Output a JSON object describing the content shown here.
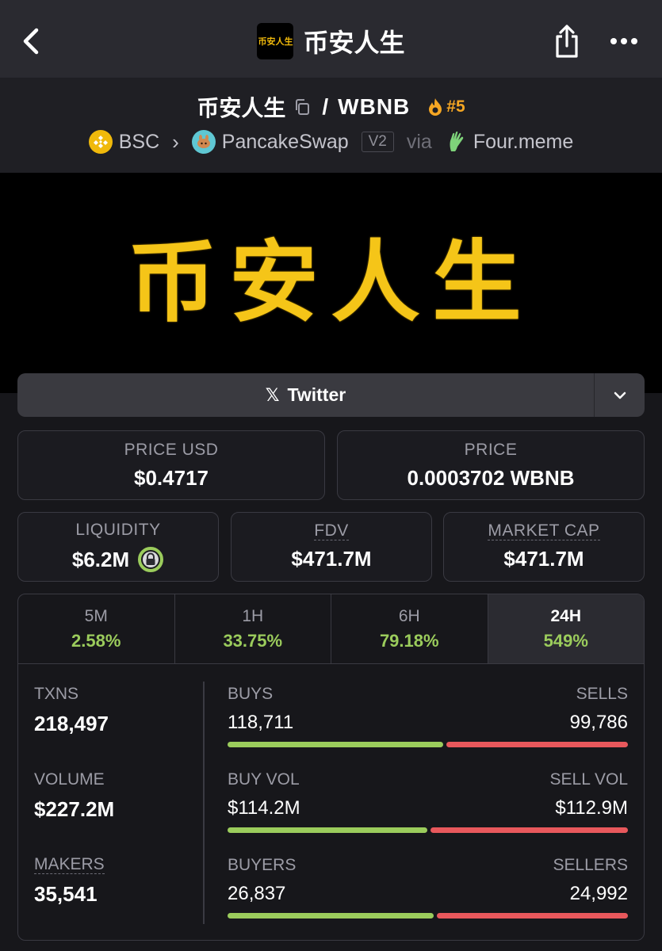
{
  "app_title": "币安人生",
  "logo_text": "币安人生",
  "pair": {
    "base": "币安人生",
    "separator": "/",
    "quote": "WBNB",
    "rank": "#5"
  },
  "breadcrumb": {
    "chain": "BSC",
    "dex": "PancakeSwap",
    "version": "V2",
    "via": "via",
    "launchpad": "Four.meme"
  },
  "banner_text": "币安人生",
  "social": {
    "label": "Twitter"
  },
  "price_usd": {
    "label": "PRICE USD",
    "value": "$0.4717"
  },
  "price": {
    "label": "PRICE",
    "value": "0.0003702 WBNB"
  },
  "liquidity": {
    "label": "LIQUIDITY",
    "value": "$6.2M"
  },
  "fdv": {
    "label": "FDV",
    "value": "$471.7M"
  },
  "market_cap": {
    "label": "MARKET CAP",
    "value": "$471.7M"
  },
  "timeframes": [
    {
      "label": "5M",
      "change": "2.58%"
    },
    {
      "label": "1H",
      "change": "33.75%"
    },
    {
      "label": "6H",
      "change": "79.18%"
    },
    {
      "label": "24H",
      "change": "549%"
    }
  ],
  "active_timeframe": "24H",
  "txns": {
    "label": "TXNS",
    "value": "218,497"
  },
  "volume": {
    "label": "VOLUME",
    "value": "$227.2M"
  },
  "makers": {
    "label": "MAKERS",
    "value": "35,541"
  },
  "buys_sells": {
    "left_label": "BUYS",
    "right_label": "SELLS",
    "left_value": "118,711",
    "right_value": "99,786",
    "buy_ratio": 0.543
  },
  "buy_sell_vol": {
    "left_label": "BUY VOL",
    "right_label": "SELL VOL",
    "left_value": "$114.2M",
    "right_value": "$112.9M",
    "buy_ratio": 0.503
  },
  "buyers_sellers": {
    "left_label": "BUYERS",
    "right_label": "SELLERS",
    "left_value": "26,837",
    "right_value": "24,992",
    "buy_ratio": 0.518
  },
  "colors": {
    "positive": "#9bcc5c",
    "negative": "#e8585c",
    "rank": "#f5a623",
    "banner_text": "#f5c518"
  }
}
